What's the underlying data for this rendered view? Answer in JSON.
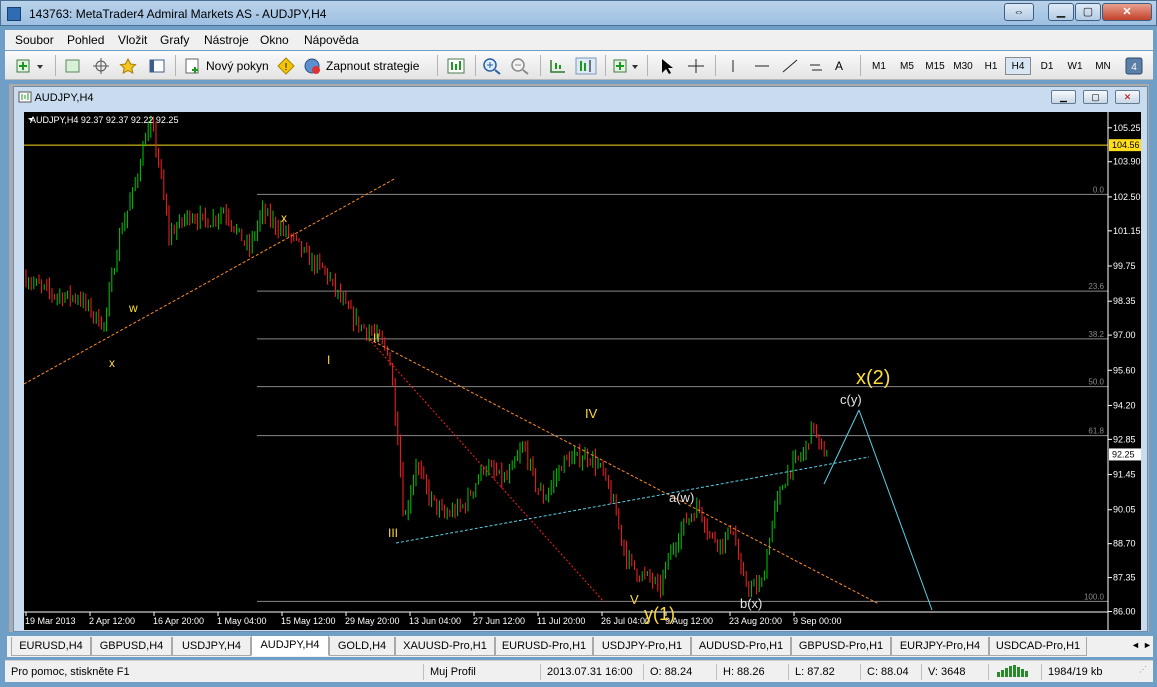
{
  "app": {
    "title": "143763: MetaTrader4 Admiral Markets AS - AUDJPY,H4"
  },
  "menu": [
    "Soubor",
    "Pohled",
    "Vložit",
    "Grafy",
    "Nástroje",
    "Okno",
    "Nápověda"
  ],
  "toolbar": {
    "new_order": "Nový pokyn",
    "strategy": "Zapnout strategie",
    "text_tool": "A",
    "timeframes": [
      "M1",
      "M5",
      "M15",
      "M30",
      "H1",
      "H4",
      "D1",
      "W1",
      "MN"
    ],
    "active_timeframe": "H4"
  },
  "chart_window": {
    "title": "AUDJPY,H4"
  },
  "chart_data": {
    "type": "candlestick",
    "title": "AUDJPY,H4  92.37 92.37 92.22 92.25",
    "last_price_label": "92.25",
    "hline_price_label": "104.56",
    "y_ticks": [
      "105.25",
      "103.90",
      "102.50",
      "101.15",
      "99.75",
      "98.35",
      "97.00",
      "95.60",
      "94.20",
      "92.85",
      "91.45",
      "90.05",
      "88.70",
      "87.35",
      "86.00"
    ],
    "x_ticks": [
      "19 Mar 2013",
      "2 Apr 12:00",
      "16 Apr 20:00",
      "1 May 04:00",
      "15 May 12:00",
      "29 May 20:00",
      "13 Jun 04:00",
      "27 Jun 12:00",
      "11 Jul 20:00",
      "26 Jul 04:00",
      "9 Aug 12:00",
      "23 Aug 20:00",
      "9 Sep 00:00"
    ],
    "fib_levels": [
      "0.0",
      "23.6",
      "38.2",
      "50.0",
      "61.8",
      "100.0"
    ],
    "wave_labels": {
      "w": "w",
      "x1": "x",
      "x2": "x",
      "i": "I",
      "ii": "II",
      "iii": "III",
      "iv": "IV",
      "v": "V",
      "y1": "y(1)",
      "aw": "a(w)",
      "bx": "b(x)",
      "cy": "c(y)",
      "x2big": "x(2)"
    },
    "ylim": [
      86.0,
      105.8
    ],
    "colors": {
      "bull": "#00c800",
      "bear": "#ff1e1e",
      "hline": "#ffdc1e",
      "fib": "#888888",
      "trend": "#ff8c28",
      "channel": "#5ad2e6",
      "label": "#ffdc3c"
    }
  },
  "tabs": [
    "EURUSD,H4",
    "GBPUSD,H4",
    "USDJPY,H4",
    "AUDJPY,H4",
    "GOLD,H4",
    "XAUUSD-Pro,H1",
    "EURUSD-Pro,H1",
    "USDJPY-Pro,H1",
    "AUDUSD-Pro,H1",
    "GBPUSD-Pro,H1",
    "EURJPY-Pro,H4",
    "USDCAD-Pro,H1"
  ],
  "active_tab": "AUDJPY,H4",
  "status": {
    "help": "Pro pomoc, stiskněte F1",
    "profile": "Muj Profil",
    "datetime": "2013.07.31 16:00",
    "open": "O: 88.24",
    "high": "H: 88.26",
    "low": "L: 87.82",
    "close": "C: 88.04",
    "volume": "V: 3648",
    "traffic": "1984/19 kb"
  }
}
